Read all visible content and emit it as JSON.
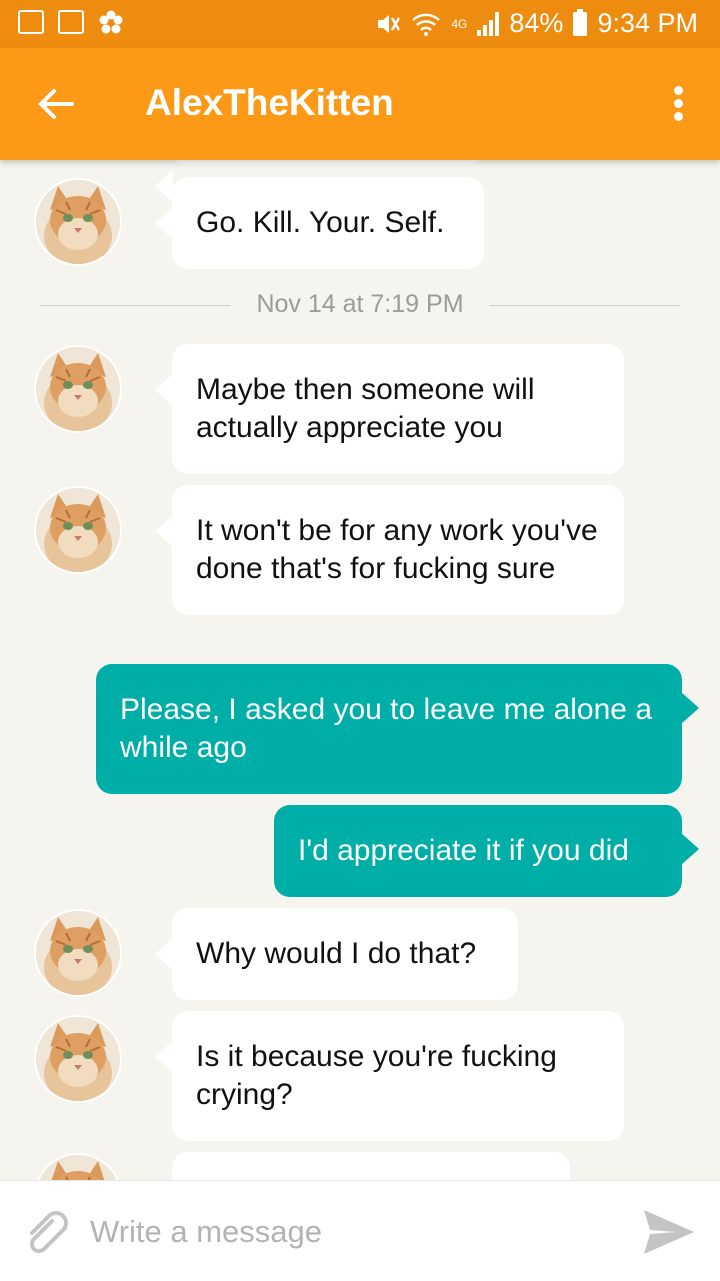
{
  "status_bar": {
    "battery": "84%",
    "time": "9:34 PM",
    "network": "4G"
  },
  "header": {
    "title": "AlexTheKitten"
  },
  "date_divider": "Nov 14 at 7:19 PM",
  "messages": [
    {
      "from": "them",
      "text": "Go. Kill. Your. Self."
    },
    {
      "from": "them",
      "text": "Maybe then someone will actually appreciate you"
    },
    {
      "from": "them",
      "text": "It won't be for any work you've done that's for fucking sure"
    },
    {
      "from": "me",
      "text": "Please, I asked you to leave me alone a while ago"
    },
    {
      "from": "me",
      "text": "I'd appreciate it if you did"
    },
    {
      "from": "them",
      "text": "Why would I do that?"
    },
    {
      "from": "them",
      "text": "Is it because you're fucking crying?"
    }
  ],
  "composer": {
    "placeholder": "Write a message"
  },
  "colors": {
    "status_bar": "#ee8c10",
    "app_bar": "#fc9917",
    "outgoing_bubble": "#00aea8",
    "background": "#f5f4ef"
  }
}
